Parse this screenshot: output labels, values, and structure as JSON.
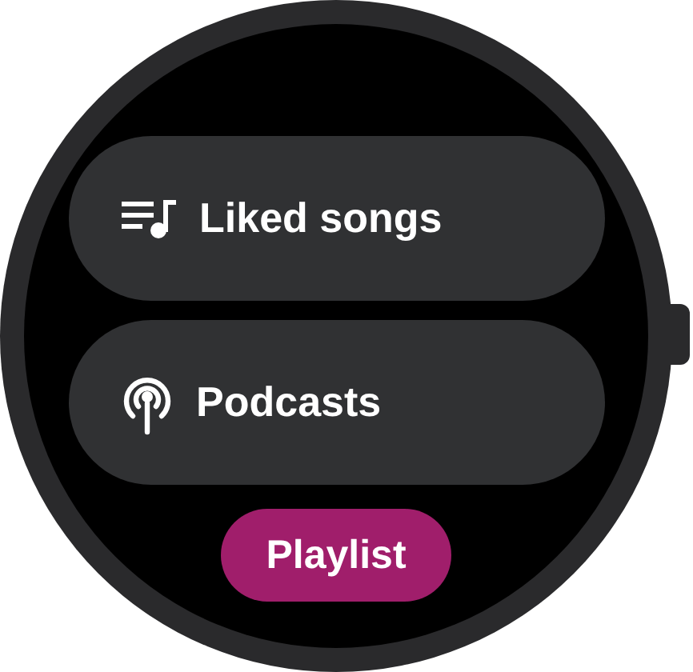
{
  "chips": [
    {
      "kind": "playlist",
      "label": "Liked songs"
    },
    {
      "kind": "podcast",
      "label": "Podcasts"
    },
    {
      "kind": "compact",
      "label": "Playlist"
    }
  ]
}
